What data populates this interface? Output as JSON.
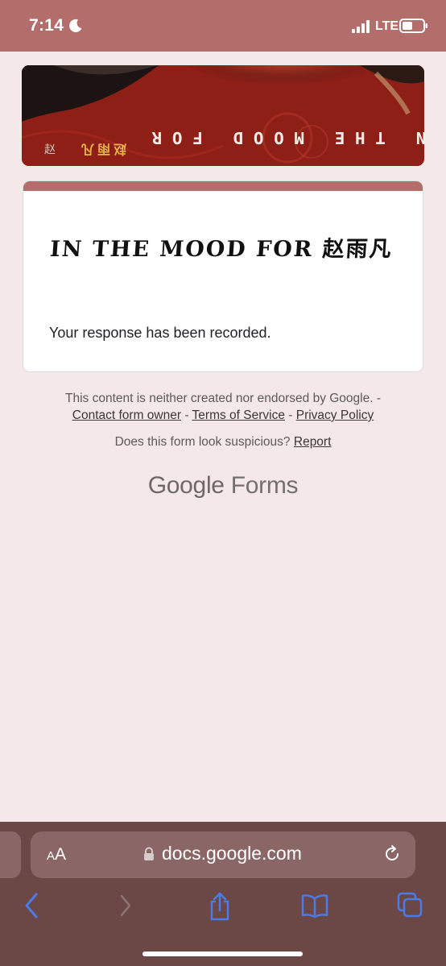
{
  "status_bar": {
    "time": "7:14",
    "network": "LTE",
    "icons": [
      "moon-icon",
      "signal-icon",
      "battery-icon"
    ]
  },
  "banner": {
    "title": "IN THE MOOD FOR",
    "cjk": "赵雨凡",
    "seal": "赵"
  },
  "form": {
    "title": "IN THE MOOD FOR 赵雨凡",
    "confirmation": "Your response has been recorded."
  },
  "footer": {
    "disclaimer": "This content is neither created nor endorsed by Google. -",
    "contact_link": "Contact form owner",
    "separator": " - ",
    "terms_link": "Terms of Service",
    "privacy_link": "Privacy Policy",
    "suspicious_text": "Does this form look suspicious?",
    "report_link": "Report",
    "brand_google": "Google",
    "brand_forms": "Forms"
  },
  "browser": {
    "text_size_label_small": "A",
    "text_size_label_large": "A",
    "url": "docs.google.com",
    "icons": [
      "lock-icon",
      "reload-icon",
      "back-icon",
      "forward-icon",
      "share-icon",
      "bookmarks-icon",
      "tabs-icon"
    ]
  },
  "colors": {
    "accent": "#b36d6b",
    "page_background": "#f4e8e8",
    "toolbar": "#6b4746",
    "link_blue": "#4a7be8"
  }
}
